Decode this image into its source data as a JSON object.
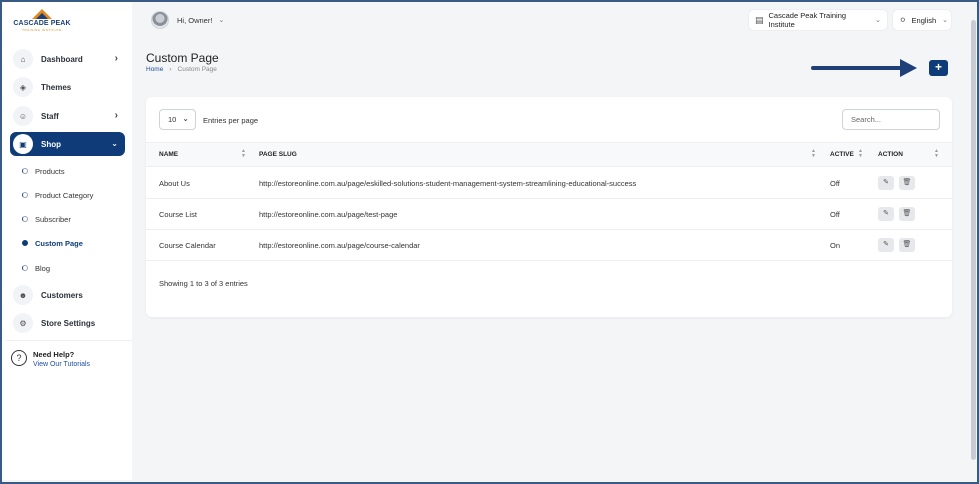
{
  "brand": {
    "logo_name": "CASCADE PEAK",
    "logo_sub": "TRAINING INSTITUTE"
  },
  "sidebar": {
    "items": [
      {
        "label": "Dashboard",
        "icon": "home-icon",
        "chevron": true
      },
      {
        "label": "Themes",
        "icon": "palette-icon",
        "chevron": false
      },
      {
        "label": "Staff",
        "icon": "users-icon",
        "chevron": true
      },
      {
        "label": "Shop",
        "icon": "shop-icon",
        "chevron": true,
        "active": true
      }
    ],
    "sub_items": [
      {
        "label": "Products"
      },
      {
        "label": "Product Category"
      },
      {
        "label": "Subscriber"
      },
      {
        "label": "Custom Page",
        "current": true
      },
      {
        "label": "Blog"
      }
    ],
    "bottom_items": [
      {
        "label": "Customers",
        "icon": "user-icon"
      },
      {
        "label": "Store Settings",
        "icon": "settings-icon"
      }
    ],
    "help": {
      "title": "Need Help?",
      "link": "View Our Tutorials"
    }
  },
  "topbar": {
    "greeting": "Hi, Owner!",
    "institute": "Cascade Peak Training Institute",
    "language": "English"
  },
  "header": {
    "title": "Custom Page",
    "breadcrumb": {
      "home": "Home",
      "current": "Custom Page"
    },
    "add_label": "+"
  },
  "table": {
    "entries_value": "10",
    "entries_label": "Entries per page",
    "search_placeholder": "Search...",
    "columns": [
      "NAME",
      "PAGE SLUG",
      "ACTIVE",
      "ACTION"
    ],
    "rows": [
      {
        "name": "About Us",
        "slug": "http://estoreonline.com.au/page/eskilled-solutions-student-management-system-streamlining-educational-success",
        "active": "Off"
      },
      {
        "name": "Course List",
        "slug": "http://estoreonline.com.au/page/test-page",
        "active": "Off"
      },
      {
        "name": "Course Calendar",
        "slug": "http://estoreonline.com.au/page/course-calendar",
        "active": "On"
      }
    ],
    "footer": "Showing 1 to 3 of 3 entries"
  },
  "colors": {
    "primary": "#0f3c78",
    "link": "#1f4ea0",
    "accent_logo": "#e08a1e"
  }
}
